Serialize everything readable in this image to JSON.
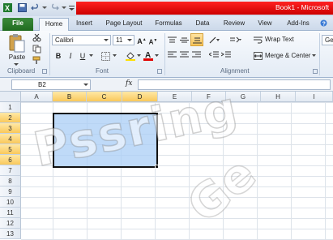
{
  "window": {
    "title": "Book1 - Microsoft"
  },
  "tabs": [
    "File",
    "Home",
    "Insert",
    "Page Layout",
    "Formulas",
    "Data",
    "Review",
    "View",
    "Add-Ins"
  ],
  "ribbon": {
    "clipboard": {
      "paste_label": "Paste",
      "group_label": "Clipboard"
    },
    "font": {
      "font_name": "Calibri",
      "font_size": "11",
      "group_label": "Font"
    },
    "alignment": {
      "wrap_text": "Wrap Text",
      "merge_center": "Merge & Center",
      "group_label": "Alignment"
    },
    "number_partial": "Ge"
  },
  "formula_bar": {
    "name_box": "B2",
    "fx_label": "fx",
    "formula": ""
  },
  "grid": {
    "columns": [
      "A",
      "B",
      "C",
      "D",
      "E",
      "F",
      "G",
      "H",
      "I"
    ],
    "rows": [
      "1",
      "2",
      "3",
      "4",
      "5",
      "6",
      "7",
      "8",
      "9",
      "10",
      "11",
      "12",
      "13"
    ],
    "selected_range": "B2:D6"
  },
  "watermark": {
    "text_left": "Pssring",
    "text_right": "Ge"
  },
  "colors": {
    "file_tab": "#2a7a2a",
    "title_bar_highlight": "#e00000",
    "selection_fill": "#aacdf5",
    "selected_header": "#f9c85b"
  }
}
